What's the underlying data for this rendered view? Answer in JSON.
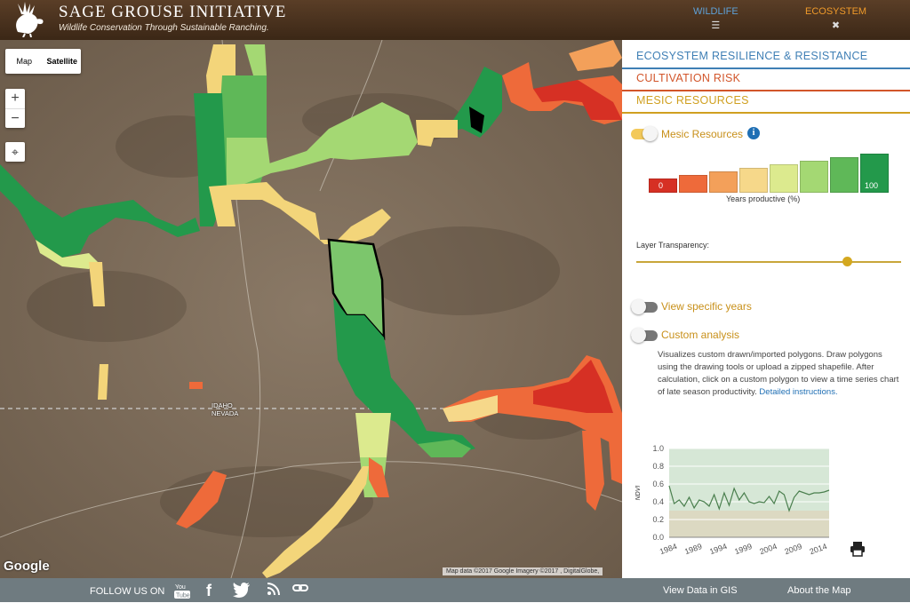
{
  "header": {
    "title": "SAGE GROUSE INITIATIVE",
    "subtitle": "Wildlife Conservation Through Sustainable Ranching.",
    "nav": [
      {
        "label": "WILDLIFE",
        "icon": "menu-icon"
      },
      {
        "label": "ECOSYSTEM",
        "icon": "close-icon"
      }
    ]
  },
  "map": {
    "map_type": {
      "map_label": "Map",
      "satellite_label": "Satellite",
      "selected": "Satellite"
    },
    "zoom_in": "+",
    "zoom_out": "−",
    "state_label_top": "IDAHO",
    "state_label_bottom": "NEVADA",
    "google_logo": "Google",
    "attribution": "Map data ©2017 Google Imagery ©2017 , DigitalGlobe,"
  },
  "panel": {
    "sections": [
      {
        "label": "ECOSYSTEM RESILIENCE & RESISTANCE",
        "color": "#3f7fb5"
      },
      {
        "label": "CULTIVATION RISK",
        "color": "#d2552a"
      },
      {
        "label": "MESIC RESOURCES",
        "color": "#d0a020"
      }
    ],
    "mesic_toggle": {
      "label": "Mesic Resources",
      "on": true
    },
    "legend": {
      "colors": [
        "#d63024",
        "#ee6a3a",
        "#f3a05a",
        "#f6d88a",
        "#dcea8e",
        "#a4d873",
        "#5fb858",
        "#23994b"
      ],
      "min_label": "0",
      "max_label": "100",
      "caption": "Years productive (%)"
    },
    "transparency_label": "Layer Transparency:",
    "transparency_value": 0.8,
    "view_years": {
      "label": "View specific years",
      "on": false
    },
    "custom_analysis": {
      "label": "Custom analysis",
      "on": false
    },
    "description": "Visualizes custom drawn/imported polygons. Draw polygons using the drawing tools or upload a zipped shapefile. After calculation, click on a custom polygon to view a time series chart of late season productivity.",
    "description_link": "Detailed instructions.",
    "accent": "#d0a020"
  },
  "chart_data": {
    "type": "line",
    "title": "",
    "xlabel": "",
    "ylabel": "NDVI",
    "xlim": [
      1984,
      2016
    ],
    "ylim": [
      0.0,
      1.0
    ],
    "x_ticks": [
      "1984",
      "1989",
      "1994",
      "1999",
      "2004",
      "2009",
      "2014"
    ],
    "y_ticks": [
      "0.0",
      "0.2",
      "0.4",
      "0.6",
      "0.8",
      "1.0"
    ],
    "bands": [
      {
        "range": [
          0.0,
          0.3
        ],
        "color": "#dcd9c2"
      },
      {
        "range": [
          0.3,
          1.0
        ],
        "color": "#d6e7d6"
      }
    ],
    "series": [
      {
        "x": [
          1984,
          1985,
          1986,
          1987,
          1988,
          1989,
          1990,
          1991,
          1992,
          1993,
          1994,
          1995,
          1996,
          1997,
          1998,
          1999,
          2000,
          2001,
          2002,
          2003,
          2004,
          2005,
          2006,
          2007,
          2008,
          2009,
          2010,
          2012,
          2013,
          2014,
          2015,
          2016
        ],
        "y": [
          0.58,
          0.38,
          0.42,
          0.35,
          0.45,
          0.33,
          0.42,
          0.4,
          0.35,
          0.48,
          0.32,
          0.5,
          0.36,
          0.55,
          0.42,
          0.5,
          0.4,
          0.38,
          0.4,
          0.39,
          0.46,
          0.38,
          0.52,
          0.48,
          0.3,
          0.45,
          0.52,
          0.48,
          0.5,
          0.5,
          0.51,
          0.53
        ],
        "color": "#4a7f4e"
      }
    ]
  },
  "footer": {
    "follow_label": "FOLLOW US ON",
    "social": [
      {
        "icon": "youtube-icon",
        "label": "You Tube"
      },
      {
        "icon": "facebook-icon",
        "label": "f"
      },
      {
        "icon": "twitter-icon",
        "label": "twitter"
      },
      {
        "icon": "rss-icon",
        "label": "rss"
      },
      {
        "icon": "link-icon",
        "label": "link"
      }
    ],
    "links": [
      "View Data in GIS",
      "About the Map"
    ]
  }
}
